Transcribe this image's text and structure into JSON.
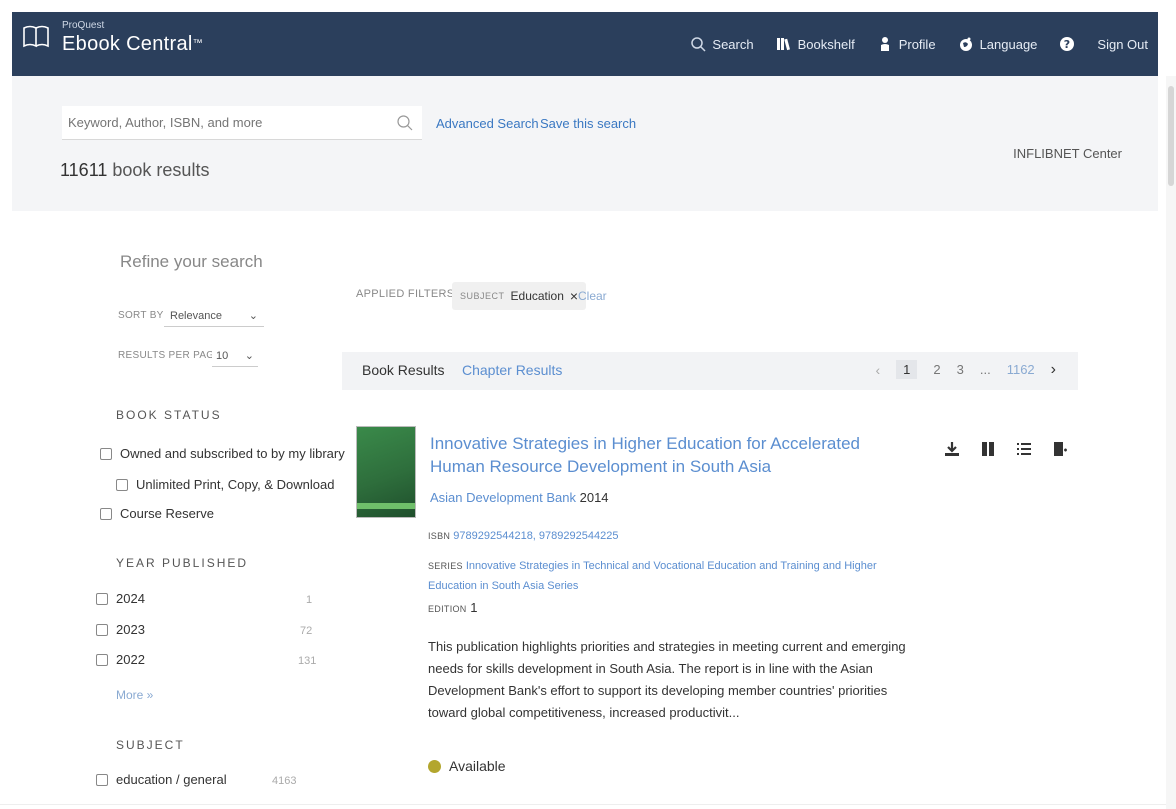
{
  "brand": {
    "small": "ProQuest",
    "name": "Ebook Central",
    "tm": "™"
  },
  "nav": {
    "search": "Search",
    "bookshelf": "Bookshelf",
    "profile": "Profile",
    "language": "Language",
    "signout": "Sign Out"
  },
  "search": {
    "placeholder": "Keyword, Author, ISBN, and more",
    "advanced": "Advanced Search",
    "save": "Save this search",
    "count": "11611",
    "count_suffix": " book results",
    "institution": "INFLIBNET Center"
  },
  "refine": {
    "title": "Refine your search",
    "sort_label": "SORT BY",
    "sort_value": "Relevance",
    "rpp_label": "RESULTS PER PAGE",
    "rpp_value": "10",
    "book_status": {
      "heading": "BOOK STATUS",
      "items": [
        "Owned and subscribed to by my library",
        "Unlimited Print, Copy, & Download",
        "Course Reserve"
      ]
    },
    "year": {
      "heading": "YEAR PUBLISHED",
      "items": [
        {
          "label": "2024",
          "count": "1"
        },
        {
          "label": "2023",
          "count": "72"
        },
        {
          "label": "2022",
          "count": "131"
        }
      ],
      "more": "More »"
    },
    "subject": {
      "heading": "SUBJECT",
      "items": [
        {
          "label": "education / general",
          "count": "4163"
        }
      ]
    }
  },
  "filters": {
    "label": "APPLIED FILTERS:",
    "chip_kind": "SUBJECT",
    "chip_value": "Education",
    "chip_x": "×",
    "clear": "Clear"
  },
  "tabs": {
    "books": "Book Results",
    "chapters": "Chapter Results"
  },
  "pager": {
    "prev": "‹",
    "pages": [
      "1",
      "2",
      "3"
    ],
    "ellipsis": "...",
    "last": "1162",
    "next": "›"
  },
  "result": {
    "title": "Innovative Strategies in Higher Education for Accelerated Human Resource Development in South Asia",
    "publisher": "Asian Development Bank",
    "year": "2014",
    "isbn_label": "ISBN",
    "isbn": "9789292544218, 9789292544225",
    "series_label": "SERIES",
    "series": "Innovative Strategies in Technical and Vocational Education and Training and Higher Education in South Asia Series",
    "edition_label": "EDITION",
    "edition": "1",
    "description": "This publication highlights priorities and strategies in meeting current and emerging needs for skills development in South Asia. The report is in line with the Asian Development Bank's effort to support its developing member countries' priorities toward global competitiveness, increased productivit...",
    "availability": "Available"
  },
  "icons": {
    "book": "book-icon",
    "search": "search-icon",
    "bookshelf": "bookshelf-icon",
    "profile": "person-icon",
    "language": "globe-icon",
    "help": "help-icon",
    "download": "download-icon",
    "read": "read-book-icon",
    "cite": "list-icon",
    "add": "add-to-bookshelf-icon"
  },
  "colors": {
    "header": "#2b3f5c",
    "link": "#5b8ed0",
    "available": "#b3a62e"
  }
}
